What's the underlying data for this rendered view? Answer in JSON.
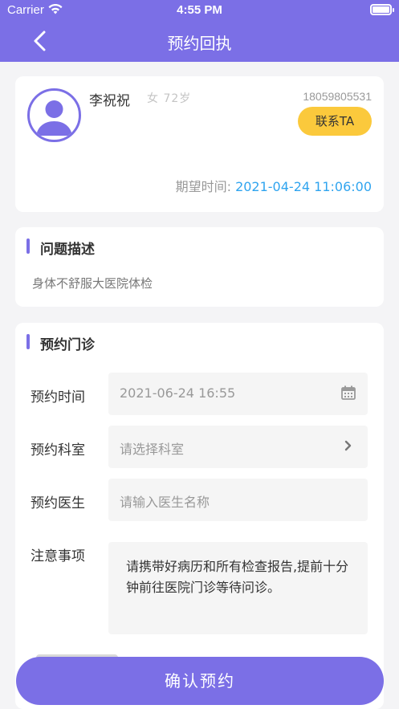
{
  "status_bar": {
    "carrier": "Carrier",
    "time": "4:55 PM"
  },
  "nav": {
    "title": "预约回执"
  },
  "patient": {
    "name": "李祝祝",
    "gender": "女",
    "age": "72岁",
    "phone": "18059805531",
    "contact_label": "联系TA",
    "expect_label": "期望时间:",
    "expect_time": "2021-04-24 11:06:00"
  },
  "problem": {
    "title": "问题描述",
    "text": "身体不舒服大医院体检"
  },
  "appointment": {
    "title": "预约门诊",
    "time_label": "预约时间",
    "time_value": "2021-06-24 16:55",
    "dept_label": "预约科室",
    "dept_placeholder": "请选择科室",
    "doctor_label": "预约医生",
    "doctor_placeholder": "请输入医生名称",
    "notes_label": "注意事项",
    "notes_text": "请携带好病历和所有检查报告,提前十分钟前往医院门诊等待问诊。"
  },
  "footer": {
    "confirm_label": "确认预约"
  },
  "colors": {
    "primary": "#7b6fe6",
    "accent_yellow": "#fbc93c",
    "link_blue": "#2fa4ef"
  },
  "icons": [
    "wifi-icon",
    "battery-icon",
    "back-arrow-icon",
    "avatar-icon",
    "calendar-icon",
    "chevron-right-icon"
  ]
}
